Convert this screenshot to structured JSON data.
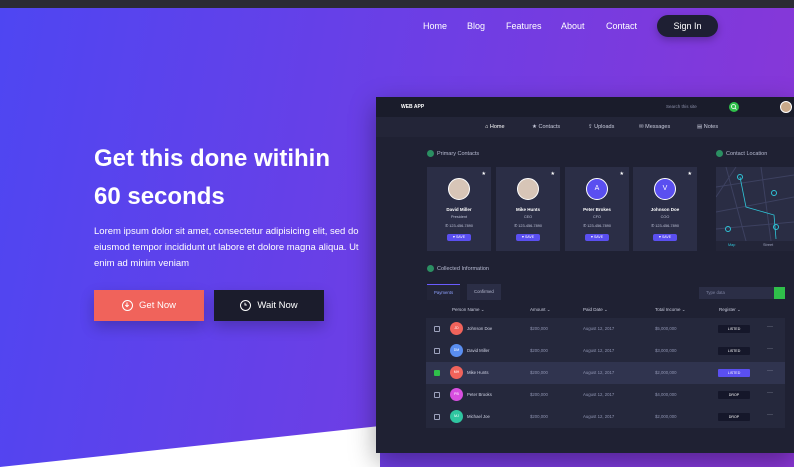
{
  "nav": {
    "items": [
      "Home",
      "Blog",
      "Features",
      "About",
      "Contact"
    ],
    "signin_label": "Sign In"
  },
  "hero": {
    "title_line1": "Get this done witihin",
    "title_line2": "60 seconds",
    "body": "Lorem ipsum dolor sit amet, consectetur adipisicing elit, sed do eiusmod tempor incididunt ut labore et dolore magna aliqua. Ut enim ad minim veniam",
    "btn_primary": "Get Now",
    "btn_secondary": "Wait Now"
  },
  "app": {
    "brand": "WEB APP",
    "search_placeholder": "Search this site",
    "tabs": [
      "Home",
      "Contacts",
      "Uploads",
      "Messages",
      "Notes"
    ],
    "primary_contacts_title": "Primary Contacts",
    "contact_location_title": "Contact Location",
    "contacts": [
      {
        "name": "David Miller",
        "role": "President",
        "phone": "✆ 123-456-7890",
        "button": "♥ SAVE",
        "avatar": "photo"
      },
      {
        "name": "Mike Hunts",
        "role": "CEO",
        "phone": "✆ 123-456-7890",
        "button": "♥ SAVE",
        "avatar": "photo"
      },
      {
        "name": "Peter Brokes",
        "role": "CFO",
        "phone": "✆ 123-456-7890",
        "button": "♥ SAVE",
        "avatar": "A"
      },
      {
        "name": "Johnson Doe",
        "role": "COO",
        "phone": "✆ 123-456-7890",
        "button": "♥ SAVE",
        "avatar": "V"
      }
    ],
    "map_tabs": [
      "Map",
      "Street"
    ],
    "collected_title": "Collected Information",
    "filter_tabs": [
      "Payments",
      "Confirmed"
    ],
    "filter_placeholder": "Type data",
    "columns": [
      "Person Name ⌄",
      "Amount ⌄",
      "Paid Date ⌄",
      "Total Income ⌄",
      "Register ⌄"
    ],
    "rows": [
      {
        "initials": "JD",
        "name": "Johnson Doe",
        "amount": "$200,000",
        "date": "August 12, 2017",
        "income": "$5,000,000",
        "status": "LISTED",
        "avatar_color": "#f0635b"
      },
      {
        "initials": "DM",
        "name": "David Miller",
        "amount": "$200,000",
        "date": "August 12, 2017",
        "income": "$3,000,000",
        "status": "LISTED",
        "avatar_color": "#5a8ef0"
      },
      {
        "initials": "MH",
        "name": "Mike Hunts",
        "amount": "$200,000",
        "date": "August 12, 2017",
        "income": "$2,000,000",
        "status": "LISTED",
        "avatar_color": "#f0635b"
      },
      {
        "initials": "PB",
        "name": "Peter Brooks",
        "amount": "$200,000",
        "date": "August 12, 2017",
        "income": "$4,000,000",
        "status": "DROP",
        "avatar_color": "#d84fe0"
      },
      {
        "initials": "MJ",
        "name": "Michael Joe",
        "amount": "$200,000",
        "date": "August 12, 2017",
        "income": "$2,000,000",
        "status": "DROP",
        "avatar_color": "#2fc5a0"
      }
    ],
    "more_label": "···"
  },
  "colors": {
    "accent": "#5a4ff0",
    "primary_button": "#f0635b",
    "dark": "#1b1c2c",
    "success": "#2fbf4a"
  }
}
